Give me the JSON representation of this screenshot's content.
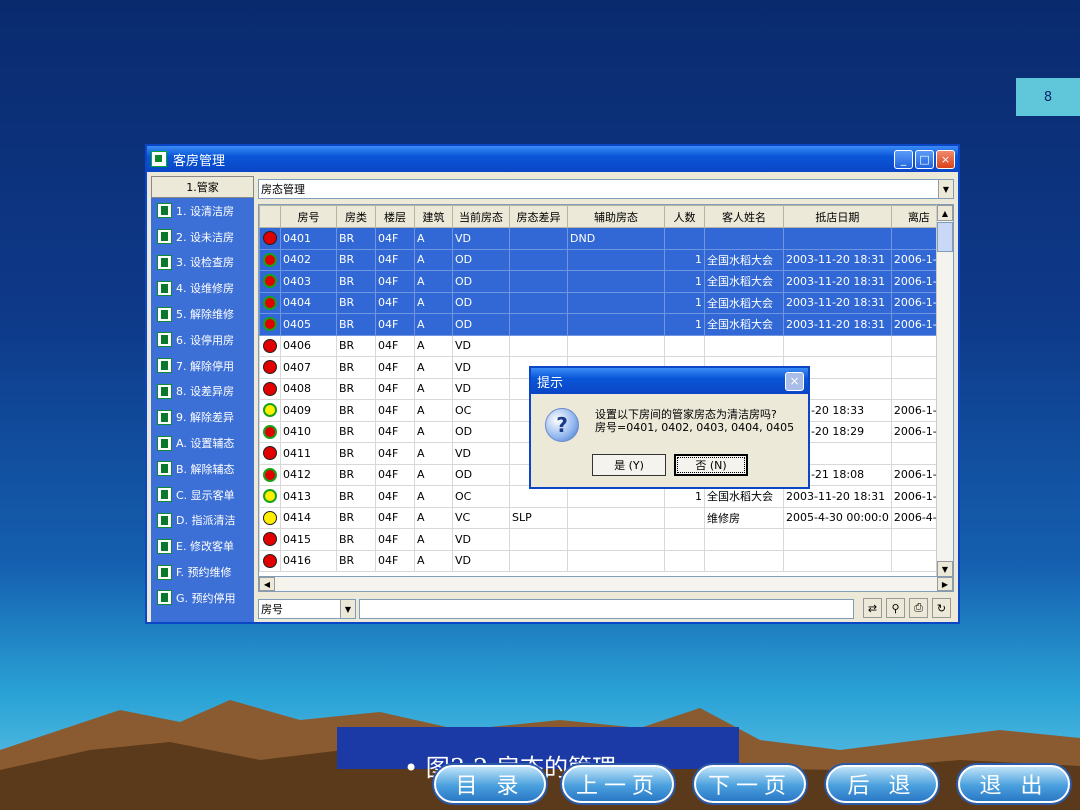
{
  "page_number": "8",
  "window": {
    "title": "客房管理",
    "buttons": [
      "_",
      "□",
      "×"
    ]
  },
  "left_panel": {
    "header": "1.管家",
    "items": [
      "1. 设清洁房",
      "2. 设未洁房",
      "3. 设检查房",
      "4. 设维修房",
      "5. 解除维修",
      "6. 设停用房",
      "7. 解除停用",
      "8. 设差异房",
      "9. 解除差异",
      "A. 设置辅态",
      "B. 解除辅态",
      "C. 显示客单",
      "D. 指派清洁",
      "E. 修改客单",
      "F. 预约维修",
      "G. 预约停用"
    ]
  },
  "view_select": {
    "value": "房态管理"
  },
  "table": {
    "columns": [
      "房号",
      "房类",
      "楼层",
      "建筑",
      "当前房态",
      "房态差异",
      "辅助房态",
      "人数",
      "客人姓名",
      "抵店日期",
      "离店"
    ],
    "rows": [
      {
        "status": "red",
        "cells": [
          "0401",
          "BR",
          "04F",
          "A",
          "VD",
          "",
          "DND",
          "",
          "",
          "",
          ""
        ],
        "selected": true
      },
      {
        "status": "red-green",
        "cells": [
          "0402",
          "BR",
          "04F",
          "A",
          "OD",
          "",
          "",
          "1",
          "全国水稻大会",
          "2003-11-20 18:31",
          "2006-1-1"
        ],
        "selected": true
      },
      {
        "status": "red-green",
        "cells": [
          "0403",
          "BR",
          "04F",
          "A",
          "OD",
          "",
          "",
          "1",
          "全国水稻大会",
          "2003-11-20 18:31",
          "2006-1-1"
        ],
        "selected": true
      },
      {
        "status": "red-green",
        "cells": [
          "0404",
          "BR",
          "04F",
          "A",
          "OD",
          "",
          "",
          "1",
          "全国水稻大会",
          "2003-11-20 18:31",
          "2006-1-1"
        ],
        "selected": true
      },
      {
        "status": "red-green",
        "cells": [
          "0405",
          "BR",
          "04F",
          "A",
          "OD",
          "",
          "",
          "1",
          "全国水稻大会",
          "2003-11-20 18:31",
          "2006-1-1"
        ],
        "selected": true
      },
      {
        "status": "red",
        "cells": [
          "0406",
          "BR",
          "04F",
          "A",
          "VD",
          "",
          "",
          "",
          "",
          "",
          ""
        ],
        "selected": false
      },
      {
        "status": "red",
        "cells": [
          "0407",
          "BR",
          "04F",
          "A",
          "VD",
          "",
          "",
          "",
          "",
          "",
          ""
        ],
        "selected": false
      },
      {
        "status": "red",
        "cells": [
          "0408",
          "BR",
          "04F",
          "A",
          "VD",
          "",
          "",
          "",
          "",
          "",
          ""
        ],
        "selected": false
      },
      {
        "status": "yellow-green",
        "cells": [
          "0409",
          "BR",
          "04F",
          "A",
          "OC",
          "",
          "",
          "",
          "",
          "3-11-20 18:33",
          "2006-1-1"
        ],
        "selected": false
      },
      {
        "status": "red-green",
        "cells": [
          "0410",
          "BR",
          "04F",
          "A",
          "OD",
          "",
          "",
          "",
          "",
          "3-11-20 18:29",
          "2006-1-1"
        ],
        "selected": false
      },
      {
        "status": "red",
        "cells": [
          "0411",
          "BR",
          "04F",
          "A",
          "VD",
          "",
          "",
          "",
          "",
          "",
          ""
        ],
        "selected": false
      },
      {
        "status": "red-green",
        "cells": [
          "0412",
          "BR",
          "04F",
          "A",
          "OD",
          "",
          "",
          "",
          "",
          "3-11-21 18:08",
          "2006-1-1"
        ],
        "selected": false
      },
      {
        "status": "yellow-green",
        "cells": [
          "0413",
          "BR",
          "04F",
          "A",
          "OC",
          "",
          "",
          "1",
          "全国水稻大会",
          "2003-11-20 18:31",
          "2006-1-1"
        ],
        "selected": false
      },
      {
        "status": "yellow",
        "cells": [
          "0414",
          "BR",
          "04F",
          "A",
          "VC",
          "SLP",
          "",
          "",
          "维修房",
          "2005-4-30 00:00:0",
          "2006-4-2"
        ],
        "selected": false
      },
      {
        "status": "red",
        "cells": [
          "0415",
          "BR",
          "04F",
          "A",
          "VD",
          "",
          "",
          "",
          "",
          "",
          ""
        ],
        "selected": false
      },
      {
        "status": "red",
        "cells": [
          "0416",
          "BR",
          "04F",
          "A",
          "VD",
          "",
          "",
          "",
          "",
          "",
          ""
        ],
        "selected": false
      }
    ]
  },
  "search": {
    "field": "房号",
    "value": ""
  },
  "dialog": {
    "title": "提示",
    "line1": "设置以下房间的管家房态为清洁房吗?",
    "line2": "房号=0401, 0402, 0403, 0404, 0405",
    "yes_label": "是 (Y)",
    "no_label": "否 (N)"
  },
  "caption": "•   图3-2  房态的管理",
  "nav": {
    "contents": "目 录",
    "prev": "上一页",
    "next": "下一页",
    "back": "后 退",
    "exit": "退 出"
  },
  "colors": {
    "selection": "#3168d5",
    "titlebar": "#0a56d8",
    "status_red": "#e00000",
    "status_green": "#1aa11a",
    "status_yellow": "#ffee00"
  }
}
